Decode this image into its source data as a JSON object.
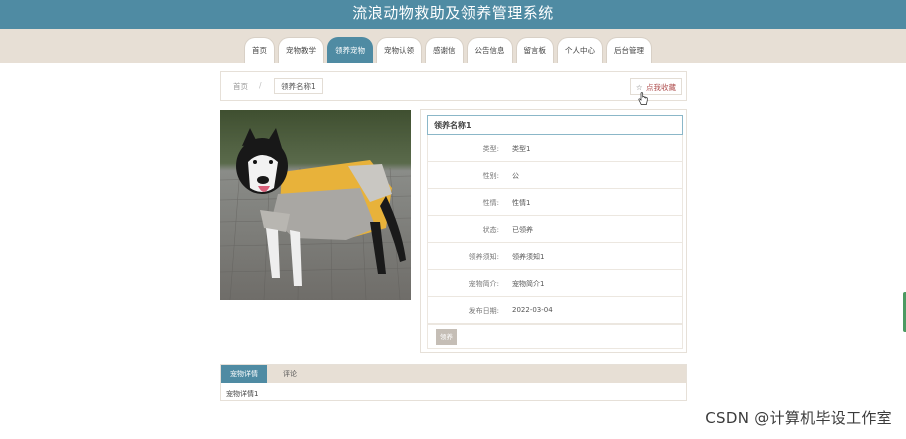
{
  "header": {
    "title": "流浪动物救助及领养管理系统",
    "nav": [
      {
        "label": "首页",
        "active": false
      },
      {
        "label": "宠物教学",
        "active": false
      },
      {
        "label": "领养宠物",
        "active": true
      },
      {
        "label": "宠物认领",
        "active": false
      },
      {
        "label": "感谢信",
        "active": false
      },
      {
        "label": "公告信息",
        "active": false
      },
      {
        "label": "留言板",
        "active": false
      },
      {
        "label": "个人中心",
        "active": false
      },
      {
        "label": "后台管理",
        "active": false
      }
    ]
  },
  "breadcrumb": {
    "home": "首页",
    "separator": "/",
    "current": "领养名称1",
    "favorite": "点我收藏",
    "favorite_icon": "star-icon"
  },
  "detail": {
    "image_alt": "宠物图片",
    "title": "领养名称1",
    "fields": [
      {
        "label": "类型:",
        "value": "类型1"
      },
      {
        "label": "性别:",
        "value": "公"
      },
      {
        "label": "性情:",
        "value": "性情1"
      },
      {
        "label": "状态:",
        "value": "已领养"
      },
      {
        "label": "领养须知:",
        "value": "领养须知1"
      },
      {
        "label": "宠物简介:",
        "value": "宠物简介1"
      },
      {
        "label": "发布日期:",
        "value": "2022-03-04"
      }
    ],
    "adopt_button": "领养"
  },
  "tabs": {
    "items": [
      "宠物详情",
      "评论"
    ],
    "active": "宠物详情",
    "content": "宠物详情1"
  },
  "watermark": "CSDN @计算机毕设工作室",
  "colors": {
    "primary": "#4f8ba3",
    "nav_bg": "#e7dfd5",
    "disabled_button": "#c5beb6"
  }
}
